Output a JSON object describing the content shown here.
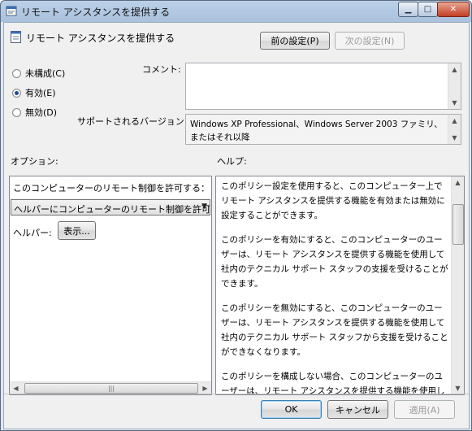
{
  "window": {
    "title": "リモート アシスタンスを提供する"
  },
  "header": {
    "policy_name": "リモート アシスタンスを提供する"
  },
  "nav": {
    "prev_label": "前の設定(P)",
    "next_label": "次の設定(N)"
  },
  "state": {
    "options": [
      {
        "label": "未構成(C)",
        "checked": false
      },
      {
        "label": "有効(E)",
        "checked": true
      },
      {
        "label": "無効(D)",
        "checked": false
      }
    ]
  },
  "comment": {
    "label": "コメント:",
    "value": ""
  },
  "supported": {
    "label": "サポートされるバージョン:",
    "value": "Windows XP Professional、Windows Server 2003 ファミリ、またはそれ以降"
  },
  "options_panel": {
    "heading": "オプション:",
    "allow_label": "このコンピューターのリモート制御を許可する：",
    "combo_value": "ヘルパーにコンピューターのリモート制御を許可す",
    "helpers_label": "ヘルパー:",
    "show_button": "表示..."
  },
  "help_panel": {
    "heading": "ヘルプ:",
    "paragraphs": [
      "このポリシー設定を使用すると、このコンピューター上でリモート アシスタンスを提供する機能を有効または無効に設定することができます。",
      "このポリシーを有効にすると、このコンピューターのユーザーは、リモート アシスタンスを提供する機能を使用して社内のテクニカル サポート スタッフの支援を受けることができます。",
      "このポリシーを無効にすると、このコンピューターのユーザーは、リモート アシスタンスを提供する機能を使用して社内のテクニカル サポート スタッフから支援を受けることができなくなります。",
      "このポリシーを構成しない場合、このコンピューターのユーザーは、リモート アシスタンスを提供する機能を使用して社内のテクニカル サポート スタッフの支援を受けることはできません。"
    ]
  },
  "footer": {
    "ok_label": "OK",
    "cancel_label": "キャンセル",
    "apply_label": "適用(A)"
  }
}
